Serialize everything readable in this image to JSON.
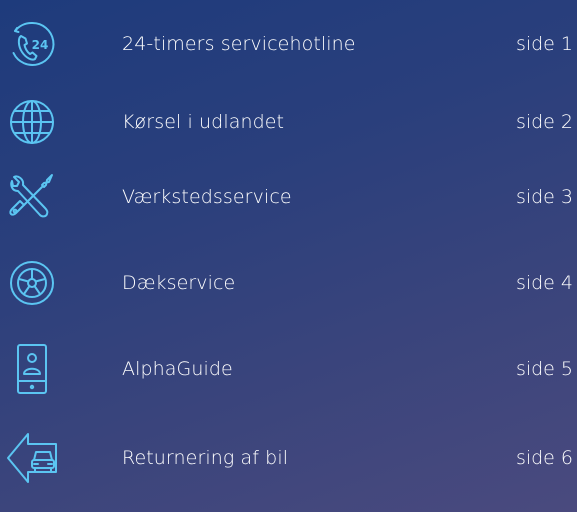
{
  "menu": {
    "items": [
      {
        "icon": "phone-24h-icon",
        "label": "24-timers servicehotline",
        "page": "side 1"
      },
      {
        "icon": "globe-icon",
        "label": "Kørsel i udlandet",
        "page": "side 2"
      },
      {
        "icon": "wrench-screwdriver-icon",
        "label": "Værkstedsservice",
        "page": "side 3"
      },
      {
        "icon": "tire-icon",
        "label": "Dækservice",
        "page": "side 4"
      },
      {
        "icon": "mobile-guide-icon",
        "label": "AlphaGuide",
        "page": "side 5"
      },
      {
        "icon": "car-return-icon",
        "label": "Returnering af bil",
        "page": "side 6"
      }
    ]
  },
  "colors": {
    "accent": "#5bc5f2",
    "text": "#ffffff",
    "background_start": "#1e3b7c",
    "background_end": "#4a4a7e"
  }
}
